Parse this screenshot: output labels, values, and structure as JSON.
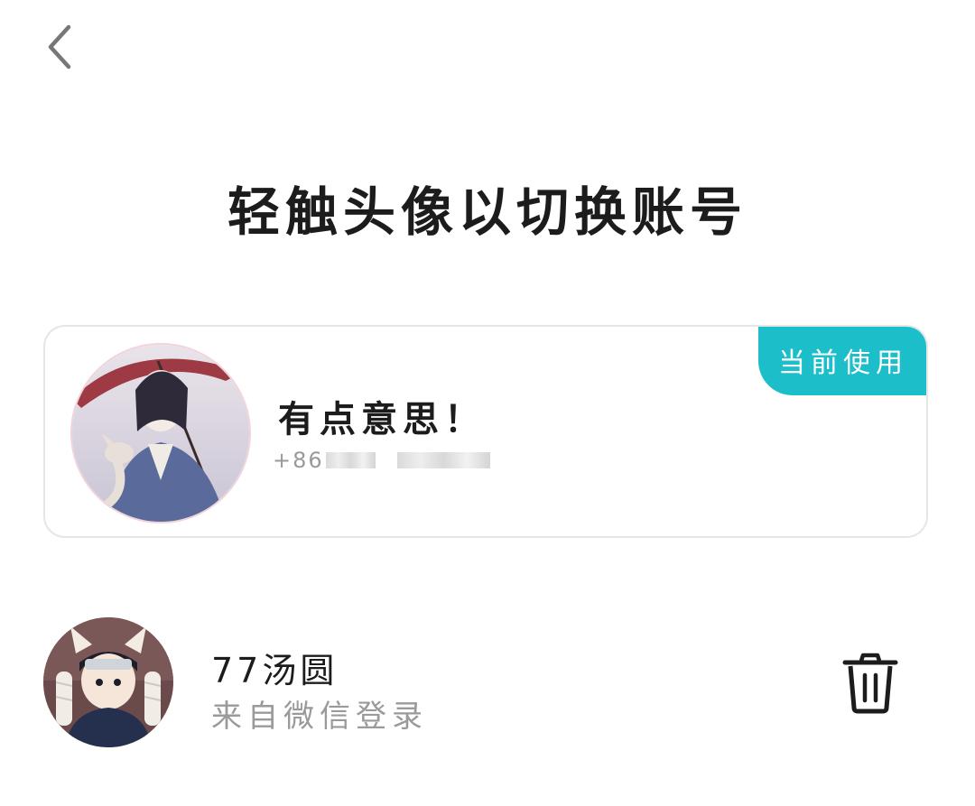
{
  "header": {
    "back_icon": "chevron-left-icon"
  },
  "title": "轻触头像以切换账号",
  "current_account": {
    "name": "有点意思！",
    "phone_prefix": "+86",
    "badge_label": "当前使用",
    "badge_color": "#1bbec9",
    "avatar_icon": "avatar-image"
  },
  "accounts": [
    {
      "name": "77汤圆",
      "source": "来自微信登录",
      "avatar_icon": "avatar-image",
      "delete_icon": "trash-icon"
    }
  ]
}
